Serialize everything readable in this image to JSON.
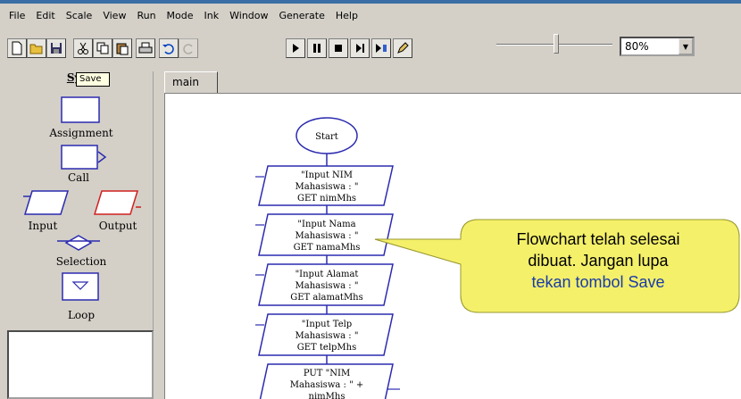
{
  "menubar": {
    "items": [
      "File",
      "Edit",
      "Scale",
      "View",
      "Run",
      "Mode",
      "Ink",
      "Window",
      "Generate",
      "Help"
    ]
  },
  "toolbar": {
    "buttons": [
      "new-file",
      "open-folder",
      "save",
      "cut",
      "copy",
      "paste",
      "print",
      "undo",
      "redo",
      "run",
      "pause",
      "stop",
      "step",
      "step-into",
      "pen"
    ],
    "tooltip": "Save",
    "zoom": "80%",
    "zoom_slider_fraction": 0.5
  },
  "symbols": {
    "header": "Sym",
    "assignment": "Assignment",
    "call": "Call",
    "input": "Input",
    "output": "Output",
    "selection": "Selection",
    "loop": "Loop"
  },
  "tabs": {
    "main": "main"
  },
  "flowchart": {
    "start": "Start",
    "blocks": [
      {
        "l1": "\"Input NIM",
        "l2": "Mahasiswa : \"",
        "l3": "GET nimMhs"
      },
      {
        "l1": "\"Input Nama",
        "l2": "Mahasiswa : \"",
        "l3": "GET namaMhs"
      },
      {
        "l1": "\"Input Alamat",
        "l2": "Mahasiswa : \"",
        "l3": "GET alamatMhs"
      },
      {
        "l1": "\"Input Telp",
        "l2": "Mahasiswa : \"",
        "l3": "GET telpMhs"
      },
      {
        "l1": "PUT \"NIM",
        "l2": "Mahasiswa : \" +",
        "l3": "nimMhs"
      }
    ]
  },
  "callout": {
    "line1": "Flowchart telah selesai",
    "line2": "dibuat. Jangan lupa",
    "line3": "tekan tombol Save"
  },
  "colors": {
    "callout_fill": "#f4f06a",
    "callout_highlight": "#1a3ca8",
    "flowchart_stroke": "#2b2bb0",
    "output_red": "#d02020"
  }
}
